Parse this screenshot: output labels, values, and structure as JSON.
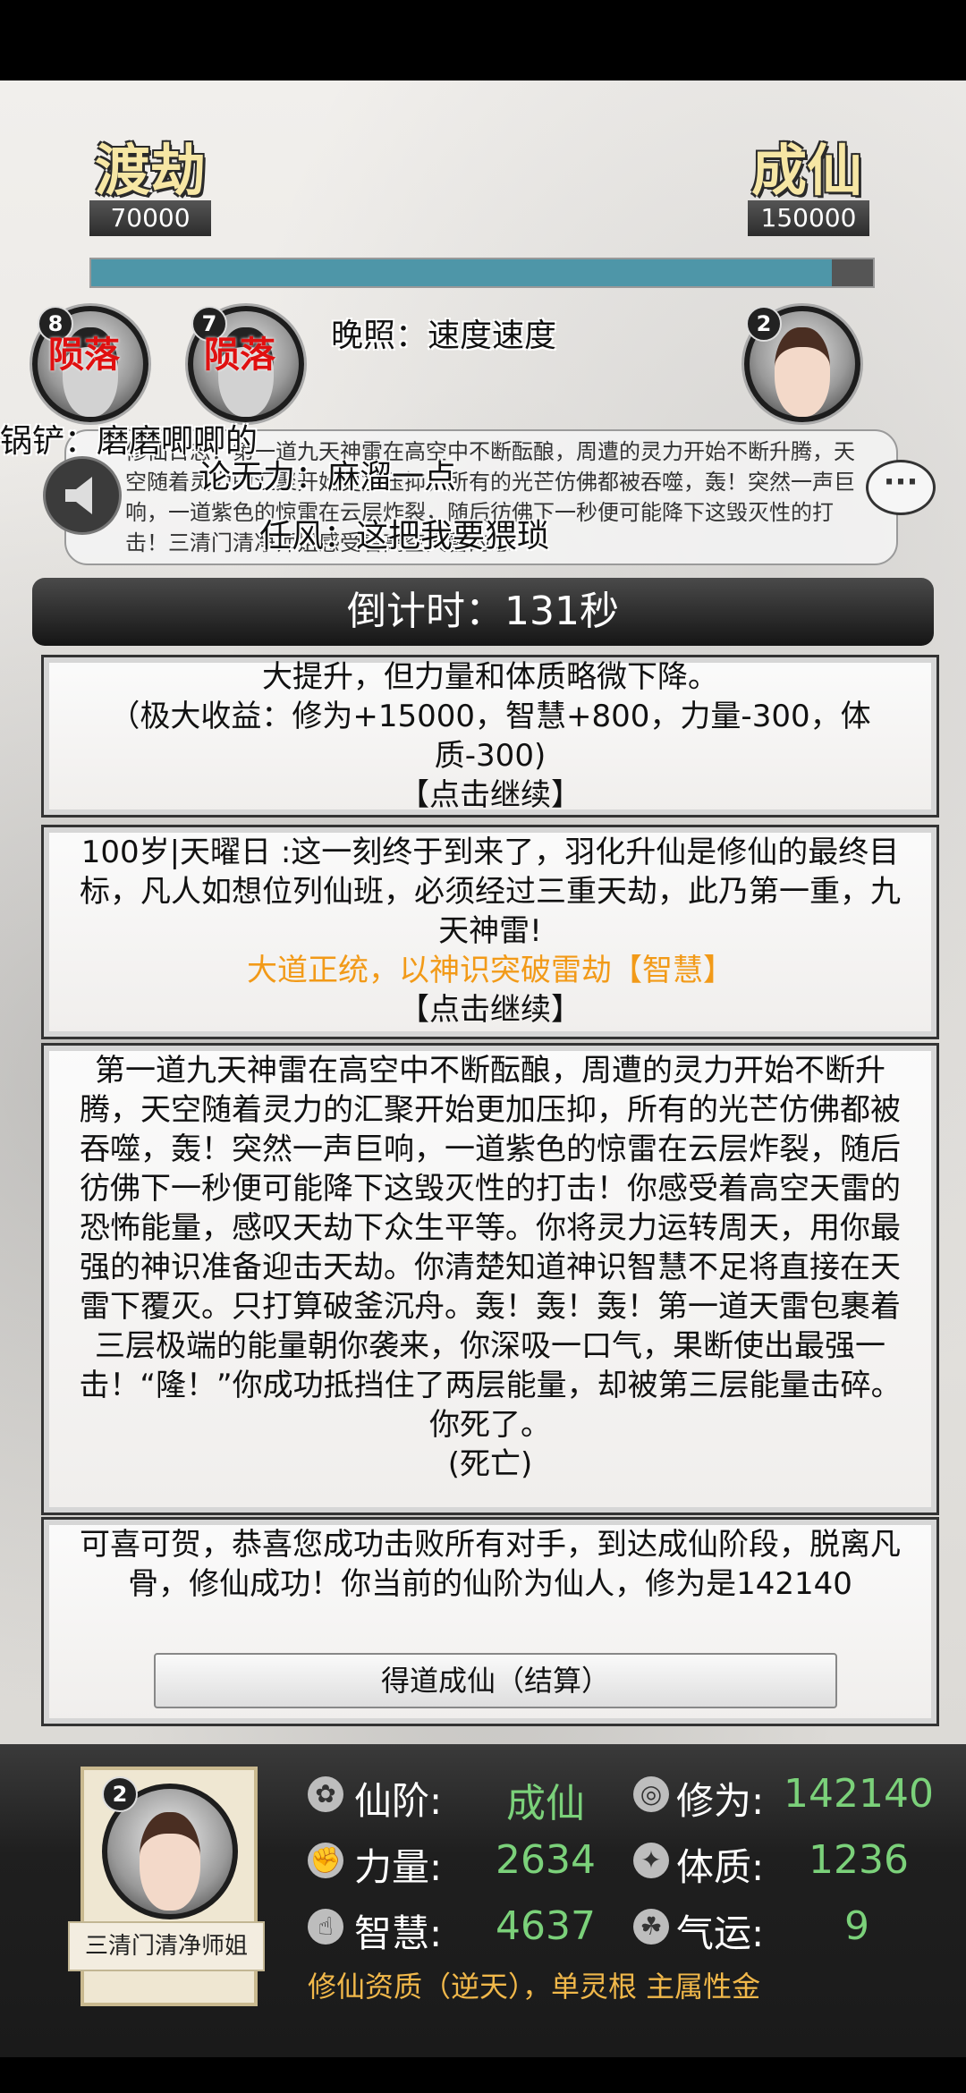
{
  "stages": {
    "left": {
      "title": "渡劫",
      "value": "70000"
    },
    "right": {
      "title": "成仙",
      "value": "150000"
    },
    "progress": 0.9476
  },
  "opponents": [
    {
      "level": "8",
      "status": "陨落"
    },
    {
      "level": "7",
      "status": "陨落"
    }
  ],
  "self_mini": {
    "level": "2"
  },
  "danmaku": [
    "晚照：速度速度",
    "锅铲：磨磨唧唧的",
    "论无力：麻溜一点",
    "任风：这把我要猥琐"
  ],
  "log_text": "修仙日志：第一道九天神雷在高空中不断酝酿，周遭的灵力开始不断升腾，天空随着灵力的汇聚开始更加压抑，所有的光芒仿佛都被吞噬，轰！突然一声巨响，一道紫色的惊雷在云层炸裂，随后彷佛下一秒便可能降下这毁灭性的打击！三清门清净师姐感受着高空天雷的恐",
  "chat_icon": "···",
  "countdown": "倒计时：131秒",
  "cards": [
    {
      "text": "大提升，但力量和体质略微下降。",
      "text2": "（极大收益：修为+15000，智慧+800，力量-300，体质-300)",
      "continue": "【点击继续】"
    },
    {
      "text": "100岁|天曜日 :这一刻终于到来了，羽化升仙是修仙的最终目标，凡人如想位列仙班，必须经过三重天劫，此乃第一重，九天神雷!",
      "choice": "大道正统，以神识突破雷劫【智慧】",
      "continue": "【点击继续】"
    },
    {
      "text": "第一道九天神雷在高空中不断酝酿，周遭的灵力开始不断升腾，天空随着灵力的汇聚开始更加压抑，所有的光芒仿佛都被吞噬，轰！突然一声巨响，一道紫色的惊雷在云层炸裂，随后彷佛下一秒便可能降下这毁灭性的打击！你感受着高空天雷的恐怖能量，感叹天劫下众生平等。你将灵力运转周天，用你最强的神识准备迎击天劫。你清楚知道神识智慧不足将直接在天雷下覆灭。只打算破釜沉舟。轰！轰！轰！第一道天雷包裹着三层极端的能量朝你袭来，你深吸一口气，果断使出最强一击！“隆！”你成功抵挡住了两层能量，却被第三层能量击碎。你死了。",
      "result": "(死亡)"
    },
    {
      "text": "可喜可贺，恭喜您成功击败所有对手，到达成仙阶段，脱离凡骨，修仙成功！你当前的仙阶为仙人，修为是142140",
      "button": "得道成仙（结算）"
    }
  ],
  "player": {
    "level": "2",
    "name": "三清门清净师姐",
    "stats": {
      "rank_label": "仙阶:",
      "rank": "成仙",
      "cult_label": "修为:",
      "cult": "142140",
      "str_label": "力量:",
      "str": "2634",
      "con_label": "体质:",
      "con": "1236",
      "wis_label": "智慧:",
      "wis": "4637",
      "luck_label": "气运:",
      "luck": "9"
    },
    "aptitude": "修仙资质（逆天），单灵根 主属性金"
  },
  "icons": [
    "rank-icon",
    "cultivation-icon",
    "strength-icon",
    "constitution-icon",
    "wisdom-icon",
    "luck-icon",
    "horn-icon",
    "chat-icon"
  ],
  "colors": {
    "accent_green": "#7bd17a",
    "choice_orange": "#f29a18",
    "fallen_red": "#e01010",
    "progress_teal": "#4e96a8"
  }
}
